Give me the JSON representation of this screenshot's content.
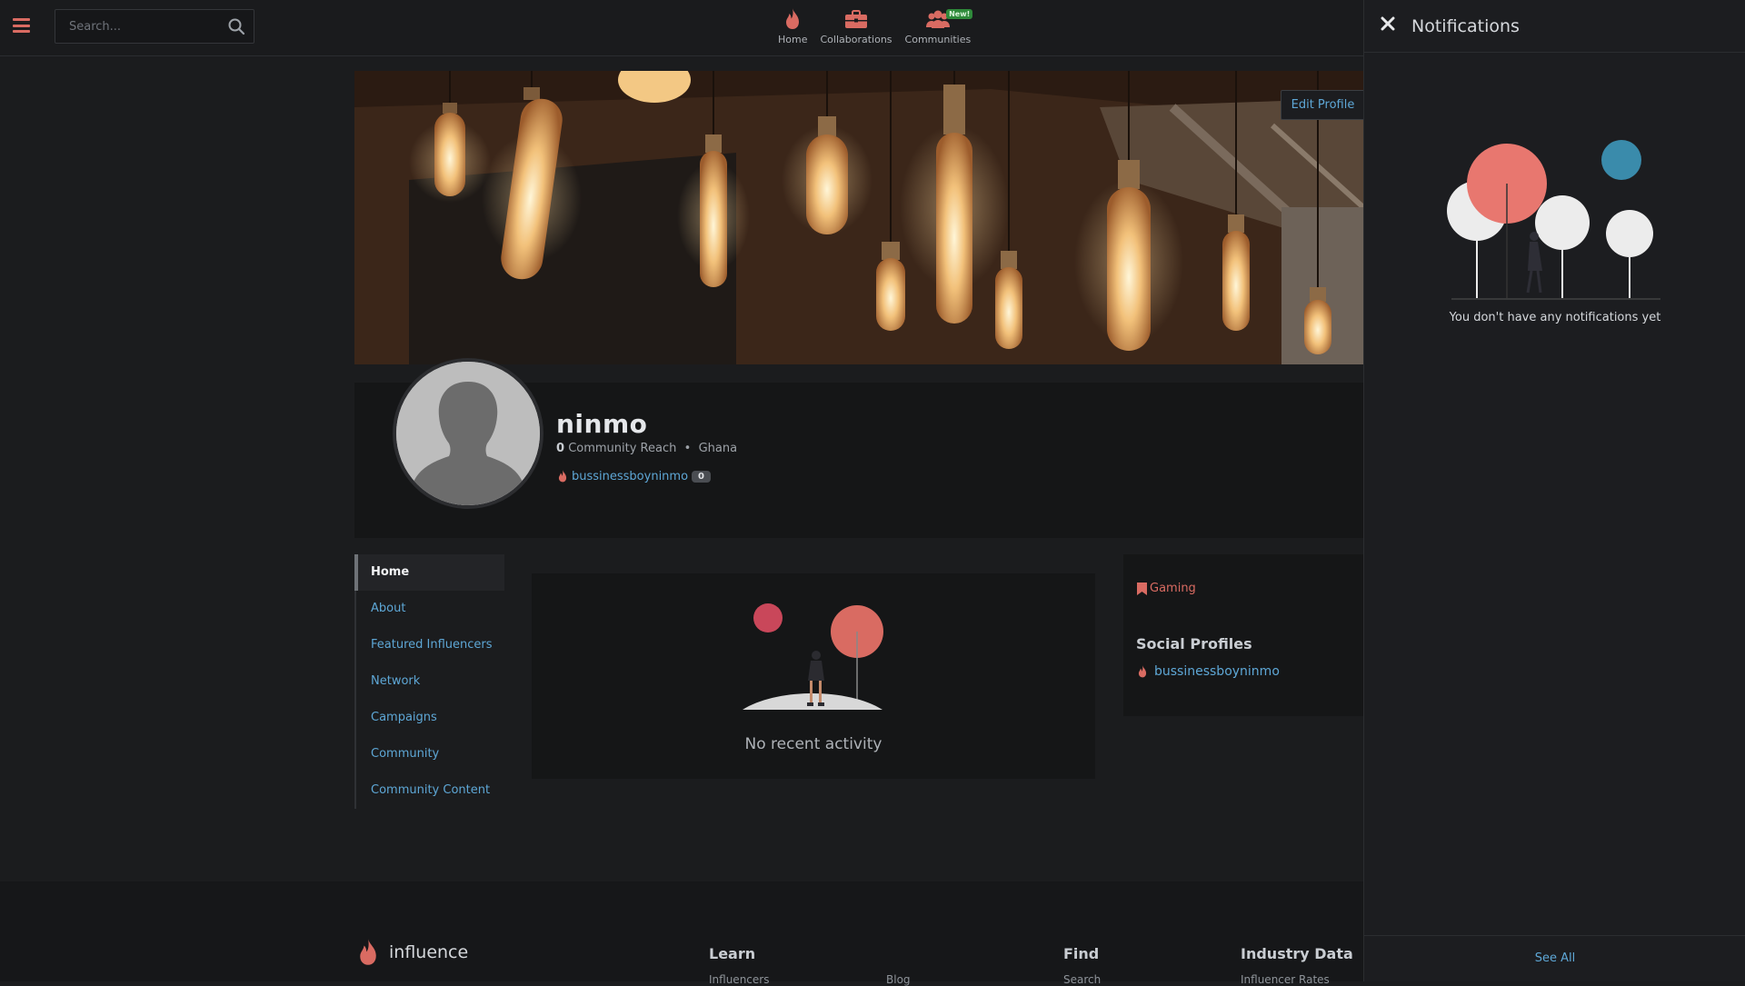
{
  "header": {
    "search_placeholder": "Search...",
    "nav": [
      {
        "label": "Home",
        "icon": "flame-icon"
      },
      {
        "label": "Collaborations",
        "icon": "briefcase-icon"
      },
      {
        "label": "Communities",
        "icon": "users-icon",
        "badge": "New!"
      }
    ]
  },
  "profile": {
    "edit_label": "Edit Profile",
    "name": "ninmo",
    "reach_count": "0",
    "reach_label": "Community Reach",
    "separator": "•",
    "country": "Ghana",
    "handle": "bussinessboyninmo",
    "handle_count": "0"
  },
  "menu": [
    {
      "label": "Home",
      "active": true
    },
    {
      "label": "About"
    },
    {
      "label": "Featured Influencers"
    },
    {
      "label": "Network"
    },
    {
      "label": "Campaigns"
    },
    {
      "label": "Community"
    },
    {
      "label": "Community Content"
    }
  ],
  "activity": {
    "empty_text": "No recent activity"
  },
  "sidebar": {
    "tag": "Gaming",
    "social_title": "Social Profiles",
    "social_handle": "bussinessboyninmo"
  },
  "footer": {
    "brand": "influence",
    "columns": [
      {
        "heading": "Learn",
        "link": "Influencers"
      },
      {
        "heading": "",
        "link": "Blog"
      },
      {
        "heading": "Find",
        "link": "Search"
      },
      {
        "heading": "Industry Data",
        "link": "Influencer Rates"
      }
    ]
  },
  "notifications": {
    "title": "Notifications",
    "empty_text": "You don't have any notifications yet",
    "see_all": "See All"
  },
  "colors": {
    "accent_red": "#d96b62",
    "link_blue": "#5ea7d6",
    "background": "#1b1c1e"
  }
}
